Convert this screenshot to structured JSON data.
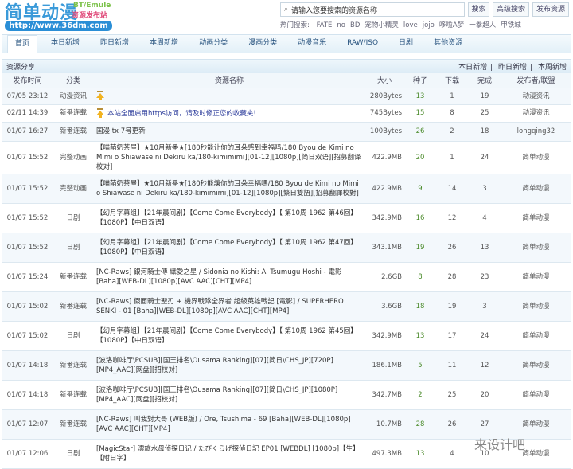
{
  "logo": {
    "name": "简单动漫",
    "tag": "BT/Emule",
    "sub": "资源发布站",
    "url": "http://www.36dm.com"
  },
  "search": {
    "placeholder": "请输入您要搜索的资源名称",
    "search_label": "搜索",
    "advanced_label": "高级搜索",
    "publish_label": "发布资源"
  },
  "hot": {
    "label": "热门搜索:",
    "terms": [
      "FATE",
      "no",
      "BD",
      "宠物小精灵",
      "love",
      "jojo",
      "哆啦A梦",
      "一拳超人",
      "甲铁城"
    ]
  },
  "nav": [
    "首页",
    "本日新增",
    "昨日新增",
    "本周新增",
    "动画分类",
    "漫画分类",
    "动漫音乐",
    "RAW/ISO",
    "日剧",
    "其他资源"
  ],
  "panel": {
    "title": "资源分享",
    "links": [
      "本日新增",
      "昨日新增",
      "本周新增"
    ]
  },
  "columns": [
    "发布时间",
    "分类",
    "资源名称",
    "大小",
    "种子",
    "下载",
    "完成",
    "发布者/联盟"
  ],
  "rows": [
    {
      "time": "07/05 23:12",
      "cat": "动漫资讯",
      "pinned": true,
      "name": "",
      "size": "280Bytes",
      "seeds": "13",
      "dl": "1",
      "done": "19",
      "pub": "动漫资讯"
    },
    {
      "time": "02/11 14:39",
      "cat": "新番连载",
      "pinned": true,
      "name": "本站全面启用https访问，请及时修正您的收藏夹!",
      "size": "745Bytes",
      "seeds": "15",
      "dl": "8",
      "done": "25",
      "pub": "动漫资讯"
    },
    {
      "time": "01/07 16:27",
      "cat": "新番连载",
      "pinned": false,
      "name": "国漫 tx 7号更新",
      "size": "100Bytes",
      "seeds": "26",
      "dl": "2",
      "done": "18",
      "pub": "longqing32"
    },
    {
      "time": "01/07 15:52",
      "cat": "完整动画",
      "pinned": false,
      "name": "【喵萌奶茶屋】★10月新番★[180秒能让你的耳朵感到幸福吗/180 Byou de Kimi no Mimi o Shiawase ni Dekiru ka/180-kimimimi][01-12][1080p][简日双语][招募翻译校对]",
      "size": "422.9MB",
      "seeds": "20",
      "dl": "1",
      "done": "24",
      "pub": "简单动漫"
    },
    {
      "time": "01/07 15:52",
      "cat": "完整动画",
      "pinned": false,
      "name": "【喵萌奶茶屋】★10月新番★[180秒能讓你的耳朵幸福嗎/180 Byou de Kimi no Mimi o Shiawase ni Dekiru ka/180-kimimimi][01-12][1080p][繁日雙語][招募翻譯校對]",
      "size": "422.9MB",
      "seeds": "9",
      "dl": "14",
      "done": "3",
      "pub": "简单动漫"
    },
    {
      "time": "01/07 15:52",
      "cat": "日剧",
      "pinned": false,
      "name": "【幻月字幕组】【21年晨间剧】【Come Come Everybody】【 第10周 1962 第46回】【1080P】【中日双语】",
      "size": "342.9MB",
      "seeds": "16",
      "dl": "12",
      "done": "4",
      "pub": "简单动漫"
    },
    {
      "time": "01/07 15:52",
      "cat": "日剧",
      "pinned": false,
      "name": "【幻月字幕组】【21年晨间剧】【Come Come Everybody】【 第10周 1962 第47回】【1080P】【中日双语】",
      "size": "343.1MB",
      "seeds": "19",
      "dl": "26",
      "done": "13",
      "pub": "简单动漫"
    },
    {
      "time": "01/07 15:24",
      "cat": "新番连载",
      "pinned": false,
      "name": "[NC-Raws] 銀河騎士傳 織愛之星 / Sidonia no Kishi: Ai Tsumugu Hoshi - 電影 [Baha][WEB-DL][1080p][AVC AAC][CHT][MP4]",
      "size": "2.6GB",
      "seeds": "8",
      "dl": "28",
      "done": "23",
      "pub": "简单动漫"
    },
    {
      "time": "01/07 15:02",
      "cat": "新番连载",
      "pinned": false,
      "name": "[NC-Raws] 假面騎士聖刃 + 機界戰隊全界者 超級英雄戰記 [電影] / SUPERHERO SENKI - 01 [Baha][WEB-DL][1080p][AVC AAC][CHT][MP4]",
      "size": "3.6GB",
      "seeds": "18",
      "dl": "19",
      "done": "3",
      "pub": "简单动漫"
    },
    {
      "time": "01/07 15:02",
      "cat": "日剧",
      "pinned": false,
      "name": "【幻月字幕组】【21年晨间剧】【Come Come Everybody】【 第10周 1962 第45回】【1080P】【中日双语】",
      "size": "342.9MB",
      "seeds": "13",
      "dl": "17",
      "done": "24",
      "pub": "简单动漫"
    },
    {
      "time": "01/07 14:18",
      "cat": "新番连载",
      "pinned": false,
      "name": "[波洛咖啡厅\\PCSUB][国王排名\\Ousama Ranking][07][简日\\CHS_JP][720P][MP4_AAC][网盘][招校对]",
      "size": "186.1MB",
      "seeds": "5",
      "dl": "11",
      "done": "12",
      "pub": "简单动漫"
    },
    {
      "time": "01/07 14:18",
      "cat": "新番连载",
      "pinned": false,
      "name": "[波洛咖啡厅\\PCSUB][国王排名\\Ousama Ranking][07][简日\\CHS_JP][1080P][MP4_AAC][网盘][招校对]",
      "size": "342.7MB",
      "seeds": "2",
      "dl": "25",
      "done": "20",
      "pub": "简单动漫"
    },
    {
      "time": "01/07 12:07",
      "cat": "新番连载",
      "pinned": false,
      "name": "[NC-Raws] 叫我對大哥 (WEB版) / Ore, Tsushima - 69 [Baha][WEB-DL][1080p][AVC AAC][CHT][MP4]",
      "size": "10.7MB",
      "seeds": "28",
      "dl": "26",
      "done": "27",
      "pub": "简单动漫"
    },
    {
      "time": "01/07 12:06",
      "cat": "日剧",
      "pinned": false,
      "name": "[MagicStar] 漂旅水母侦探日记 / たびくらげ探偵日記 EP01 [WEBDL] [1080p]【生】【附日字】",
      "size": "497.3MB",
      "seeds": "13",
      "dl": "4",
      "done": "10",
      "pub": "简单动漫"
    }
  ],
  "watermark": "来设计吧",
  "colors": {
    "accent": "#2a8ed6",
    "seed": "#4a8a2a",
    "link": "#2a3a9a"
  }
}
